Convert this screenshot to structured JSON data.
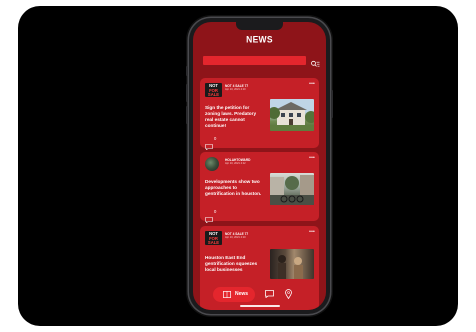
{
  "app": {
    "title": "NEWS"
  },
  "search": {
    "placeholder": ""
  },
  "posts": [
    {
      "logo": [
        "NOT",
        "FOR SALE"
      ],
      "handle": "NOT 4 SALE 77",
      "date": "Apr 10, 2021 4:10",
      "headline": "Sign the petition for zoning laws. Predatory real estate cannot continue!",
      "comments": "0",
      "image": "house-photo"
    },
    {
      "handle": "HOLAHTOWARD",
      "date": "Apr 10, 2021 4:12",
      "headline": "Developments show two approaches to gentrification in houston.",
      "comments": "0",
      "image": "street-photo"
    },
    {
      "logo": [
        "NOT",
        "FOR SALE"
      ],
      "handle": "NOT 4 SALE 77",
      "date": "Apr 10, 2021 4:10",
      "headline": "Houston East End gentrification squeezes local businesses",
      "comments": "",
      "image": "event-photo"
    }
  ],
  "nav": {
    "news_label": "News",
    "icons": [
      "news-icon",
      "chat-icon",
      "location-pin-icon"
    ]
  },
  "colors": {
    "background": "#8e1419",
    "card": "#c52027",
    "accent": "#e4262d",
    "text": "#ffffff"
  }
}
